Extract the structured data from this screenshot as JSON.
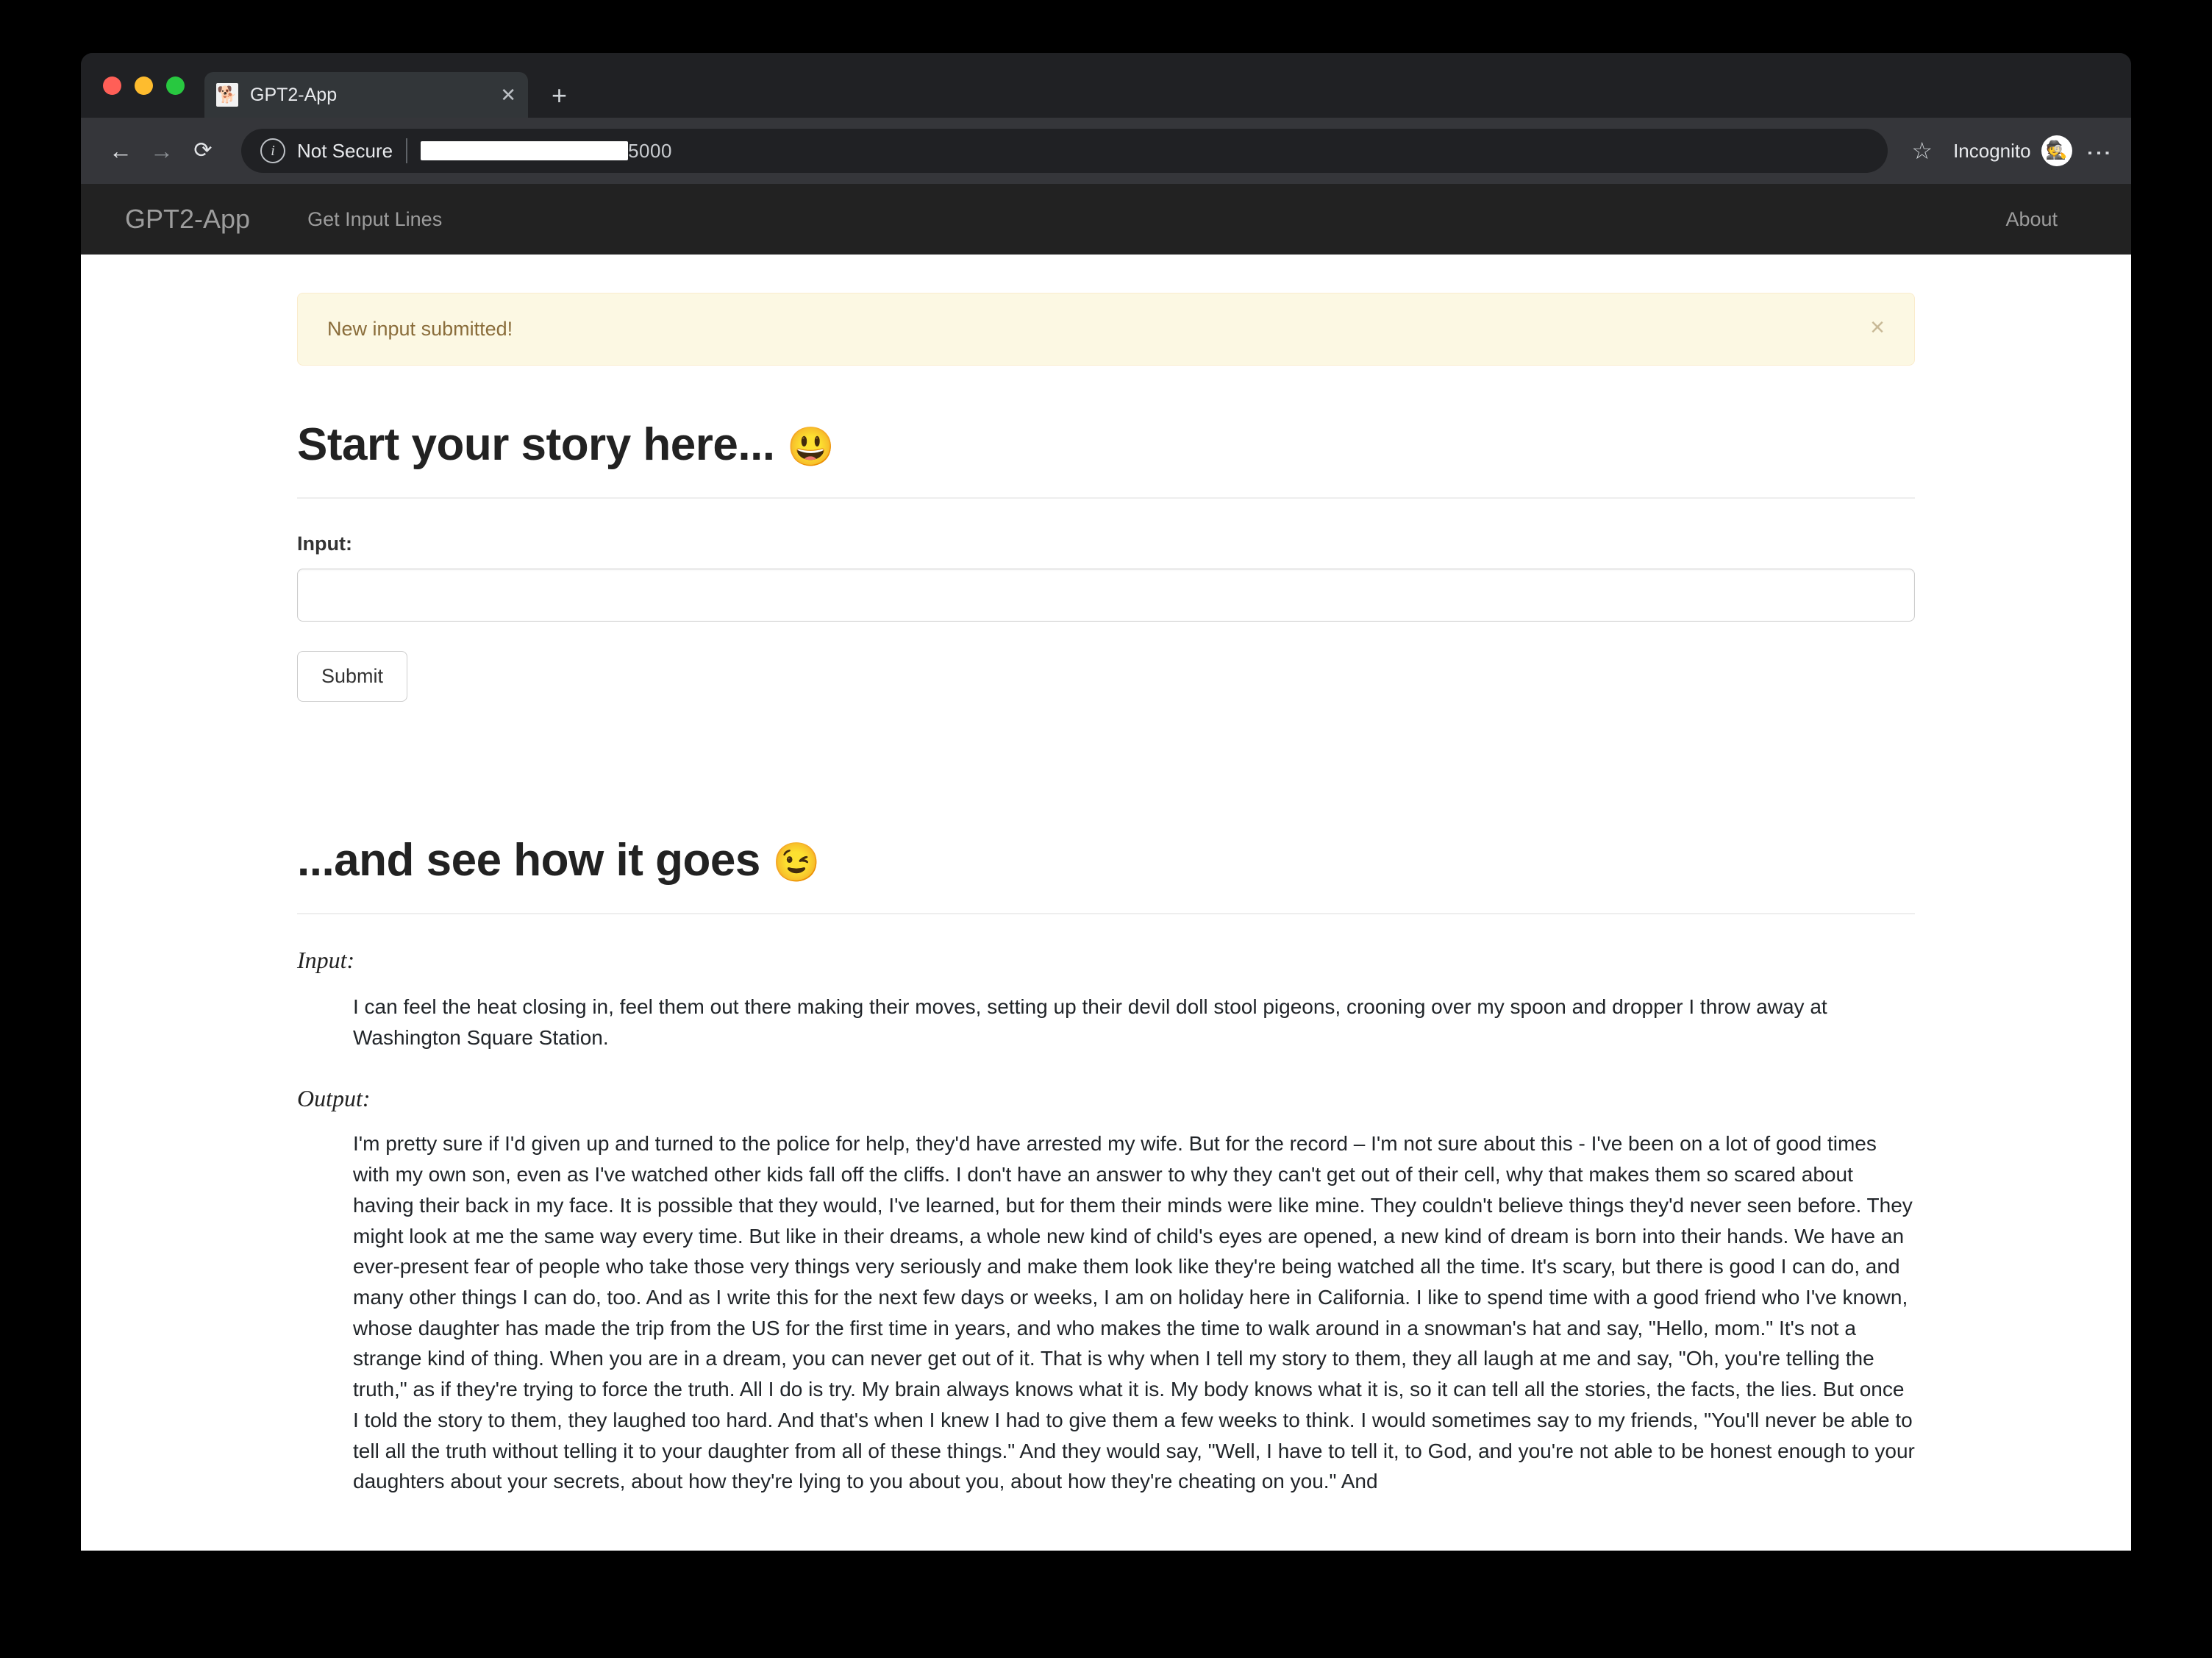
{
  "browser": {
    "tab": {
      "title": "GPT2-App",
      "favicon_icon": "document-icon",
      "close_icon": "close-icon"
    },
    "new_tab_icon": "plus-icon",
    "back_icon": "arrow-left-icon",
    "forward_icon": "arrow-right-icon",
    "reload_icon": "reload-icon",
    "security": {
      "info_icon": "info-icon",
      "label": "Not Secure"
    },
    "url": {
      "redacted": "",
      "visible_tail": "5000"
    },
    "bookmark_icon": "star-icon",
    "profile": {
      "label": "Incognito",
      "avatar_icon": "incognito-icon"
    },
    "menu_icon": "kebab-menu-icon"
  },
  "navbar": {
    "brand": "GPT2-App",
    "links": [
      {
        "label": "Get Input Lines"
      }
    ],
    "right_links": [
      {
        "label": "About"
      }
    ]
  },
  "alert": {
    "message": "New input submitted!",
    "close_icon": "×",
    "bg_color": "#fcf8e3",
    "text_color": "#8a6d3b"
  },
  "form_section": {
    "heading": "Start your story here...",
    "heading_emoji": "😃",
    "input_label": "Input:",
    "input_value": "",
    "input_placeholder": "",
    "submit_label": "Submit"
  },
  "result_section": {
    "heading": "...and see how it goes",
    "heading_emoji": "😉",
    "input_label": "Input:",
    "input_text": "I can feel the heat closing in, feel them out there making their moves, setting up their devil doll stool pigeons, crooning over my spoon and dropper I throw away at Washington Square Station.",
    "output_label": "Output:",
    "output_text": "I'm pretty sure if I'd given up and turned to the police for help, they'd have arrested my wife. But for the record – I'm not sure about this - I've been on a lot of good times with my own son, even as I've watched other kids fall off the cliffs. I don't have an answer to why they can't get out of their cell, why that makes them so scared about having their back in my face. It is possible that they would, I've learned, but for them their minds were like mine. They couldn't believe things they'd never seen before. They might look at me the same way every time. But like in their dreams, a whole new kind of child's eyes are opened, a new kind of dream is born into their hands. We have an ever-present fear of people who take those very things very seriously and make them look like they're being watched all the time. It's scary, but there is good I can do, and many other things I can do, too. And as I write this for the next few days or weeks, I am on holiday here in California. I like to spend time with a good friend who I've known, whose daughter has made the trip from the US for the first time in years, and who makes the time to walk around in a snowman's hat and say, \"Hello, mom.\" It's not a strange kind of thing. When you are in a dream, you can never get out of it. That is why when I tell my story to them, they all laugh at me and say, \"Oh, you're telling the truth,\" as if they're trying to force the truth. All I do is try. My brain always knows what it is. My body knows what it is, so it can tell all the stories, the facts, the lies. But once I told the story to them, they laughed too hard. And that's when I knew I had to give them a few weeks to think. I would sometimes say to my friends, \"You'll never be able to tell all the truth without telling it to your daughter from all of these things.\" And they would say, \"Well, I have to tell it, to God, and you're not able to be honest enough to your daughters about your secrets, about how they're lying to you about you, about how they're cheating on you.\" And"
  }
}
